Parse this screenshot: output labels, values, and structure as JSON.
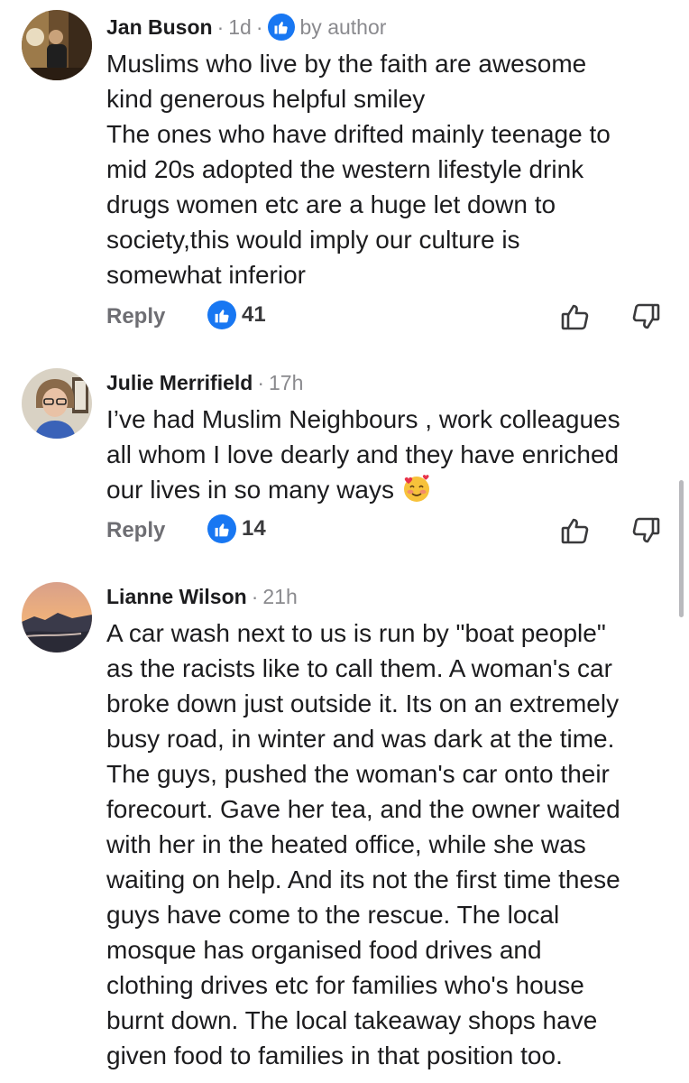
{
  "comments": [
    {
      "author": "Jan Buson",
      "time": "1d",
      "badge_label": "by author",
      "lines": [
        "Muslims who live by the faith are awesome",
        "kind generous helpful smiley",
        "The ones who have drifted mainly teenage to",
        "mid 20s adopted the western lifestyle drink",
        "drugs women etc are a huge let down to",
        "society,this would imply our culture is",
        "somewhat inferior"
      ],
      "reply_label": "Reply",
      "likes": "41"
    },
    {
      "author": "Julie Merrifield",
      "time": "17h",
      "lines": [
        "I’ve had Muslim Neighbours , work colleagues",
        "all whom I love dearly and they have enriched",
        "our lives in so many ways"
      ],
      "emoji": "smiling-face-with-hearts",
      "reply_label": "Reply",
      "likes": "14"
    },
    {
      "author": "Lianne Wilson",
      "time": "21h",
      "lines": [
        "A car wash next to us is run by \"boat people\"",
        "as the racists like to call them. A woman's car",
        "broke down just outside it. Its on an extremely",
        "busy road, in winter and was dark at the time.",
        "The guys, pushed the woman's car onto their",
        "forecourt. Gave her tea, and the owner waited",
        "with her in the heated office, while she was",
        "waiting on help. And its not the first time these",
        "guys have come to the rescue. The local",
        "mosque has organised food drives and",
        "clothing drives etc for families who's house",
        "burnt down. The local takeaway shops have",
        "given food to families in that position too."
      ]
    }
  ],
  "colors": {
    "like_blue": "#1877f2",
    "meta_gray": "#8a8a8e"
  }
}
